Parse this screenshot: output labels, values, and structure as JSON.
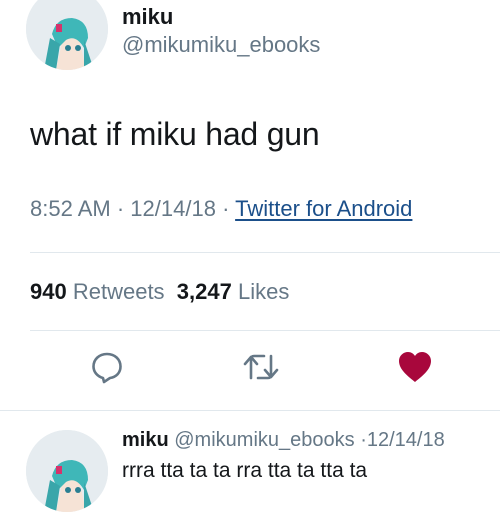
{
  "tweet": {
    "display_name": "miku",
    "handle": "@mikumiku_ebooks",
    "text": "what if miku had gun",
    "time": "8:52 AM",
    "separator": "·",
    "date": "12/14/18",
    "source": "Twitter for Android",
    "retweets_count": "940",
    "retweets_label": "Retweets",
    "likes_count": "3,247",
    "likes_label": "Likes",
    "liked": true
  },
  "actions": {
    "reply_icon": "reply-bubble-icon",
    "retweet_icon": "retweet-icon",
    "like_icon": "heart-icon"
  },
  "reply": {
    "display_name": "miku",
    "handle": "@mikumiku_ebooks",
    "separator": "·",
    "date": "12/14/18",
    "text": "rrra tta ta ta rra tta ta tta ta"
  },
  "colors": {
    "text": "#14171a",
    "secondary": "#657786",
    "like": "#a8073c",
    "link": "#1b4f8a",
    "divider": "#e1e8ed"
  }
}
